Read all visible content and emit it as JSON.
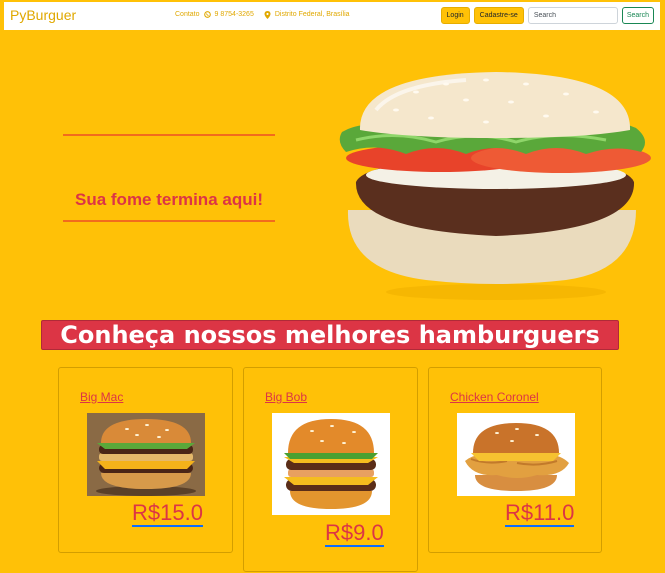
{
  "navbar": {
    "brand": "PyBurguer",
    "contact_label": "Contato",
    "phone": "9 8754-3265",
    "location": "Distrito Federal, Brasília",
    "login_label": "Login",
    "signup_label": "Cadastre-se",
    "search_placeholder": "Search",
    "search_button": "Search"
  },
  "hero": {
    "slogan": "Sua fome termina aqui!"
  },
  "section": {
    "title": "Conheça nossos melhores hamburguers"
  },
  "products": [
    {
      "name": "Big Mac",
      "price": "R$15.0"
    },
    {
      "name": "Big Bob",
      "price": "R$9.0"
    },
    {
      "name": "Chicken Coronel",
      "price": "R$11.0"
    }
  ],
  "colors": {
    "background": "#ffc107",
    "accent_red": "#dc3545",
    "link_underline": "#0d6efd",
    "search_green": "#198754"
  }
}
